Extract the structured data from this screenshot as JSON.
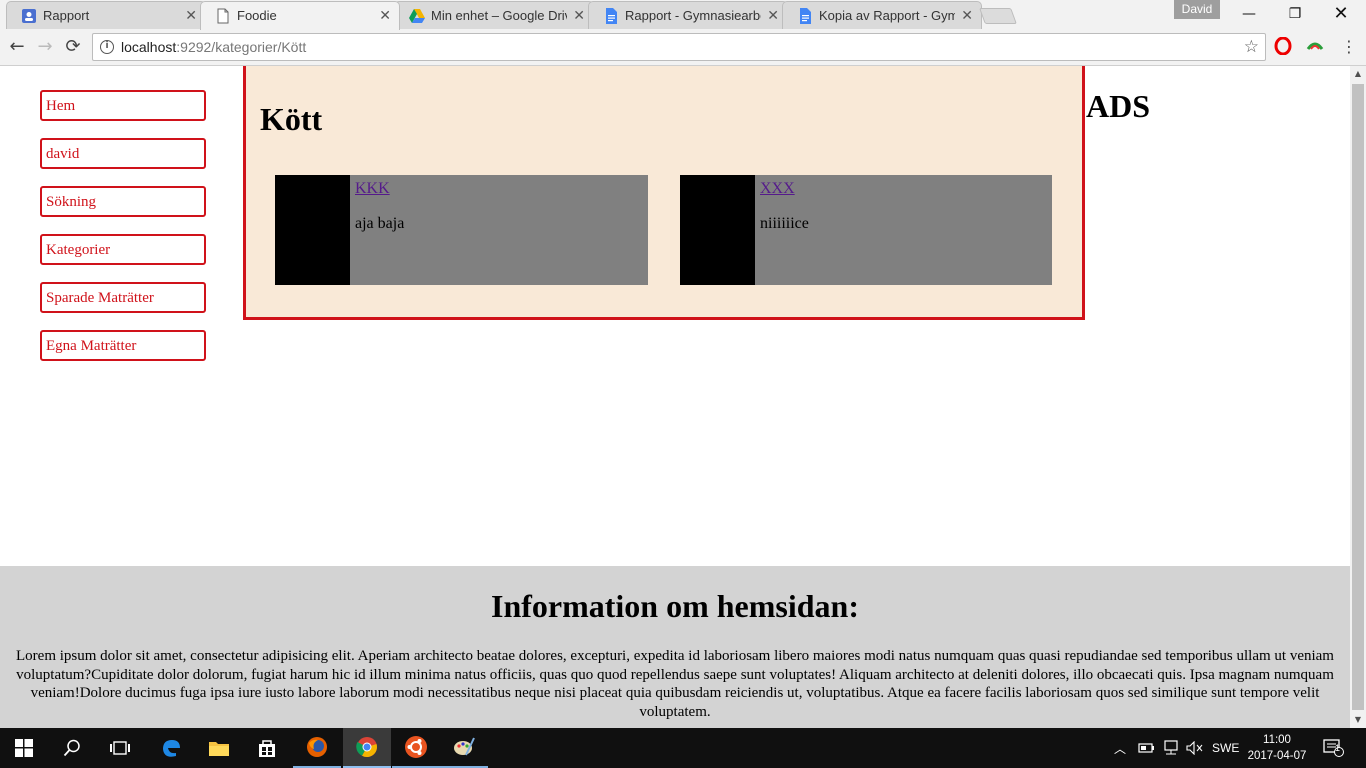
{
  "browser": {
    "tabs": [
      {
        "title": "Rapport",
        "icon": "contacts-icon",
        "active": false
      },
      {
        "title": "Foodie",
        "icon": "page-icon",
        "active": true
      },
      {
        "title": "Min enhet – Google Drive",
        "icon": "google-drive-icon",
        "active": false
      },
      {
        "title": "Rapport - Gymnasiearbete",
        "icon": "google-docs-icon",
        "active": false
      },
      {
        "title": "Kopia av Rapport - Gymnasiearbete",
        "icon": "google-docs-icon",
        "active": false
      }
    ],
    "profile_name": "David",
    "url_host": "localhost",
    "url_rest": ":9292/kategorier/Kött"
  },
  "sidebar": {
    "items": [
      {
        "label": "Hem"
      },
      {
        "label": "david"
      },
      {
        "label": "Sökning"
      },
      {
        "label": "Kategorier"
      },
      {
        "label": "Sparade Maträtter"
      },
      {
        "label": "Egna Maträtter"
      }
    ]
  },
  "main": {
    "heading": "Kött",
    "cards": [
      {
        "title": "KKK",
        "description": "aja baja"
      },
      {
        "title": "XXX",
        "description": "niiiiiice"
      }
    ]
  },
  "ads_label": "ADS",
  "footer": {
    "heading": "Information om hemsidan:",
    "text": "Lorem ipsum dolor sit amet, consectetur adipisicing elit. Aperiam architecto beatae dolores, excepturi, expedita id laboriosam libero maiores modi natus numquam quas quasi repudiandae sed temporibus ullam ut veniam voluptatum?Cupiditate dolor dolorum, fugiat harum hic id illum minima natus officiis, quas quo quod repellendus saepe sunt voluptates! Aliquam architecto at deleniti dolores, illo obcaecati quis. Ipsa magnam numquam veniam!Dolore ducimus fuga ipsa iure iusto labore laborum modi necessitatibus neque nisi placeat quia quibusdam reiciendis ut, voluptatibus. Atque ea facere facilis laboriosam quos sed similique sunt tempore velit voluptatem."
  },
  "taskbar": {
    "language": "SWE",
    "time": "11:00",
    "date": "2017-04-07",
    "notification_count": "1"
  },
  "colors": {
    "accent_red": "#d0121a",
    "content_bg": "#f9e9d7",
    "card_bg": "#808080",
    "footer_bg": "#d3d3d3",
    "link_visited": "#551a8b"
  }
}
